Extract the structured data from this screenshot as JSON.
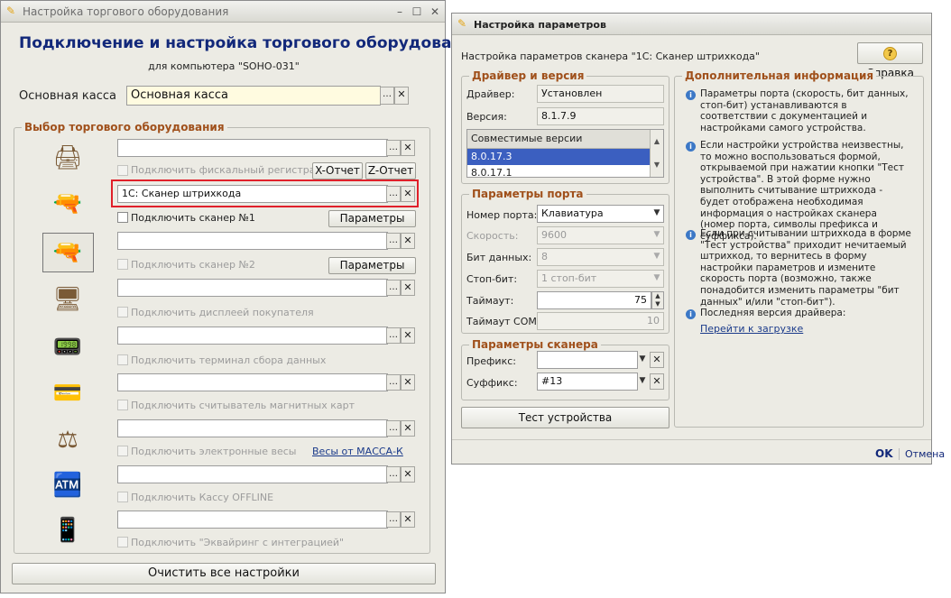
{
  "win1": {
    "title": "Настройка торгового оборудования",
    "heading": "Подключение и настройка торгового оборудования",
    "subheading": "для компьютера \"SOHO-031\"",
    "main_cash_label": "Основная касса",
    "main_cash_value": "Основная касса",
    "group_title": "Выбор торгового оборудования",
    "fiscal_label": "Подключить фискальный регистратор",
    "x_report": "X-Отчет",
    "z_report": "Z-Отчет",
    "scanner1_value": "1С: Сканер штрихкода",
    "scanner1_label": "Подключить сканер №1",
    "params1": "Параметры",
    "scanner2_label": "Подключить сканер №2",
    "params2": "Параметры",
    "display_label": "Подключить дисплеей покупателя",
    "terminal_label": "Подключить терминал сбора данных",
    "magnetic_label": "Подключить считыватель магнитных карт",
    "scales_label": "Подключить электронные весы",
    "scales_link": "Весы от МАССА-К",
    "offline_label": "Подключить Кассу OFFLINE",
    "acquiring_label": "Подключить \"Эквайринг с интеграцией\"",
    "clear_button": "Очистить все настройки"
  },
  "win2": {
    "title": "Настройка параметров",
    "header_text": "Настройка параметров сканера \"1С: Сканер штрихкода\"",
    "help_button": "Справка",
    "driver_group": "Драйвер и версия",
    "driver_label": "Драйвер:",
    "driver_value": "Установлен",
    "version_label": "Версия:",
    "version_value": "8.1.7.9",
    "compat_header": "Совместимые версии",
    "compat_items": [
      "8.0.17.3",
      "8.0.17.1"
    ],
    "port_group": "Параметры порта",
    "port_label": "Номер порта:",
    "port_value": "Клавиатура",
    "speed_label": "Скорость:",
    "speed_value": "9600",
    "bits_label": "Бит данных:",
    "bits_value": "8",
    "stop_label": "Стоп-бит:",
    "stop_value": "1 стоп-бит",
    "timeout_label": "Таймаут:",
    "timeout_value": "75",
    "timeout_com_label": "Таймаут COM:",
    "timeout_com_value": "10",
    "scanner_group": "Параметры сканера",
    "prefix_label": "Префикс:",
    "prefix_value": "",
    "suffix_label": "Суффикс:",
    "suffix_value": "#13",
    "test_button": "Тест устройства",
    "info_group": "Дополнительная информация",
    "info1": "Параметры порта (скорость, бит данных, стоп-бит) устанавливаются в соответствии с документацией и настройками самого устройства.",
    "info2": "Если настройки устройства неизвестны, то можно воспользоваться формой, открываемой при нажатии кнопки \"Тест устройства\". В этой форме нужно выполнить считывание штрихкода - будет отображена необходимая информация о настройках сканера (номер порта, символы префикса и суффикса).",
    "info3": "Если при считывании штрихкода в форме \"Тест устройства\" приходит нечитаемый штрихкод, то вернитесь в форму настройки параметров и измените скорость порта (возможно, также понадобится изменить параметры \"бит данных\" и/или \"стоп-бит\").",
    "info4": "Последняя версия драйвера:",
    "download_link": "Перейти к загрузке",
    "ok_button": "OK",
    "cancel_button": "Отмена"
  },
  "colors": {
    "accent_title": "#a0501b",
    "highlight": "#e0202a",
    "selection": "#3b5fc0"
  }
}
